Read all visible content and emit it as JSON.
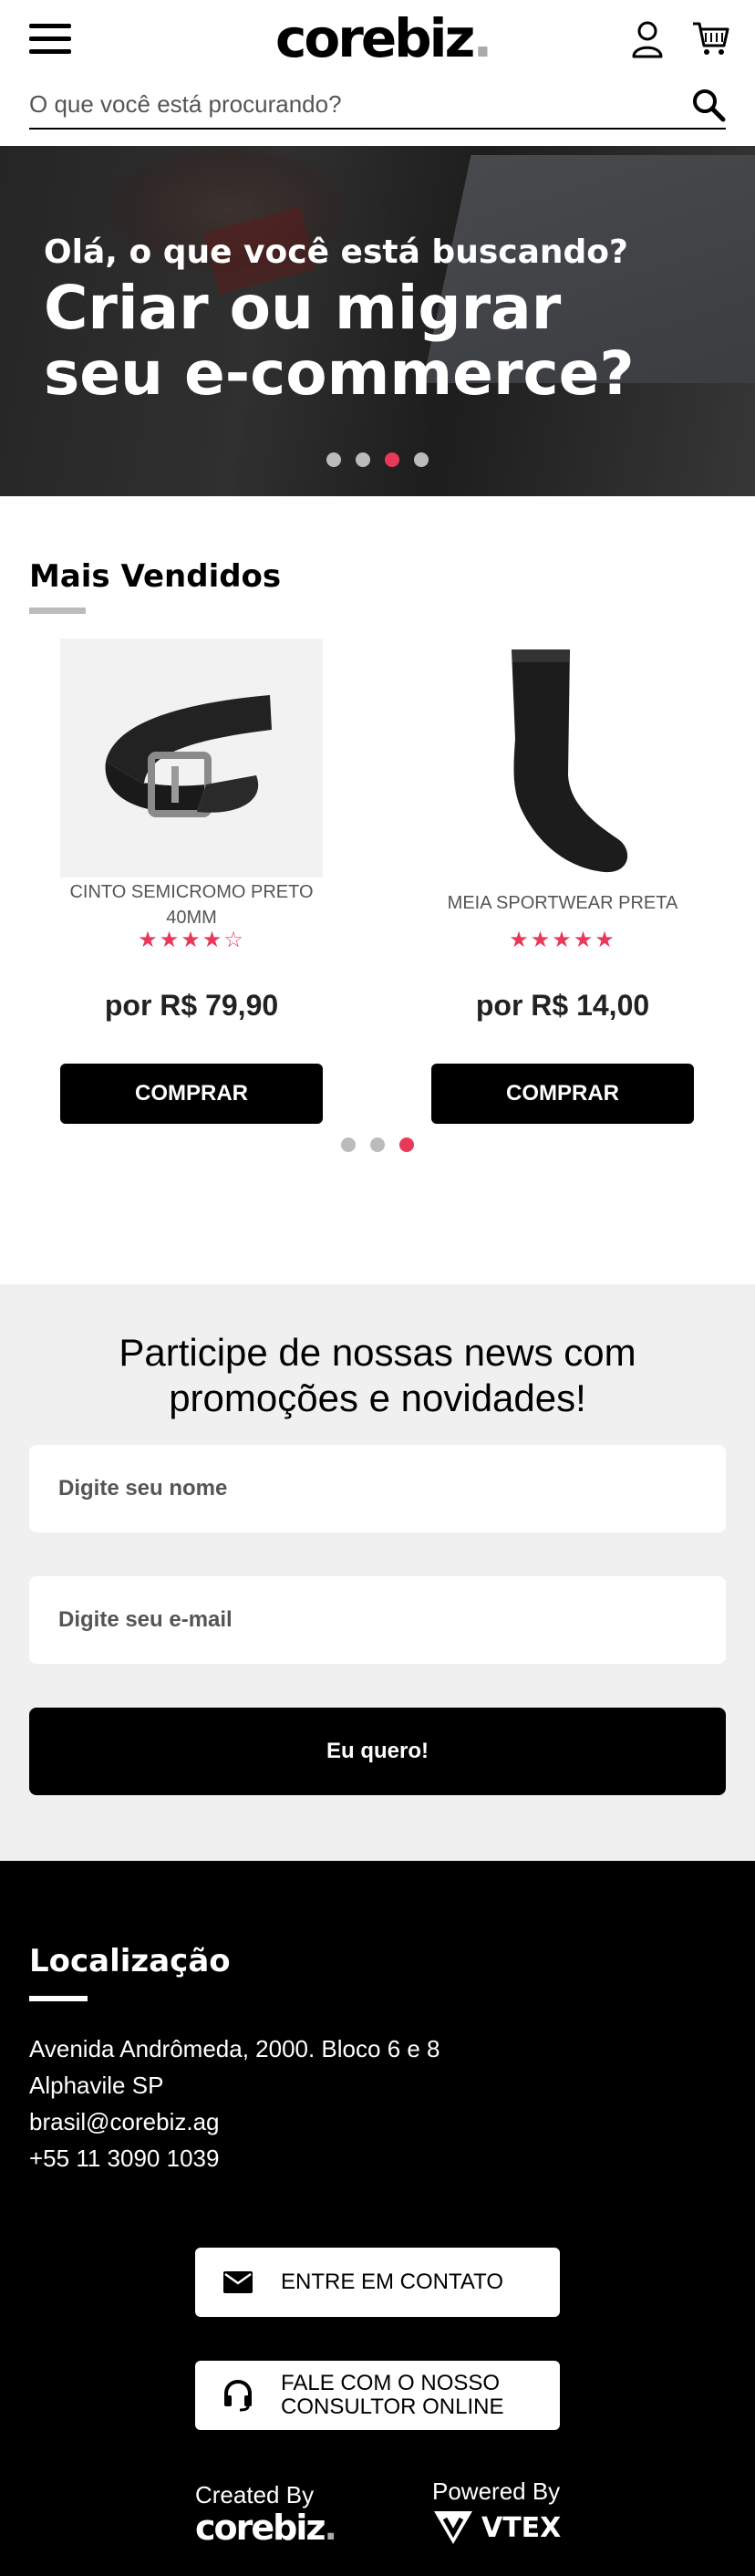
{
  "header": {
    "logo_text": "corebiz",
    "logo_dot": ".",
    "search_placeholder": "O que você está procurando?"
  },
  "banner": {
    "subtitle": "Olá, o que você está buscando?",
    "title_line1": "Criar ou migrar",
    "title_line2": "seu e-commerce?",
    "slides": 4,
    "active_slide": 3
  },
  "best_sellers": {
    "title": "Mais Vendidos",
    "products": [
      {
        "name": "CINTO SEMICROMO PRETO 40MM",
        "rating": 4,
        "stars": "★★★★☆",
        "price": "por R$ 79,90",
        "button": "COMPRAR"
      },
      {
        "name": "MEIA SPORTWEAR PRETA",
        "rating": 5,
        "stars": "★★★★★",
        "price": "por R$ 14,00",
        "button": "COMPRAR"
      }
    ],
    "pages": 3,
    "active_page": 3
  },
  "newsletter": {
    "title": "Participe de nossas news com promoções e novidades!",
    "name_placeholder": "Digite seu nome",
    "email_placeholder": "Digite seu e-mail",
    "submit_label": "Eu quero!"
  },
  "footer": {
    "title": "Localização",
    "address_line1": "Avenida Andrômeda, 2000. Bloco 6 e 8",
    "address_line2": "Alphavile SP",
    "email": "brasil@corebiz.ag",
    "phone": "+55 11 3090 1039",
    "contact_button": "ENTRE EM CONTATO",
    "consultant_button_line1": "FALE COM O NOSSO",
    "consultant_button_line2": "CONSULTOR ONLINE",
    "created_by": "Created By",
    "created_logo": "corebiz",
    "powered_by": "Powered By",
    "powered_logo": "VTEX"
  },
  "colors": {
    "accent": "#e8395a",
    "dark": "#000000",
    "light_bg": "#f0f0f0"
  }
}
